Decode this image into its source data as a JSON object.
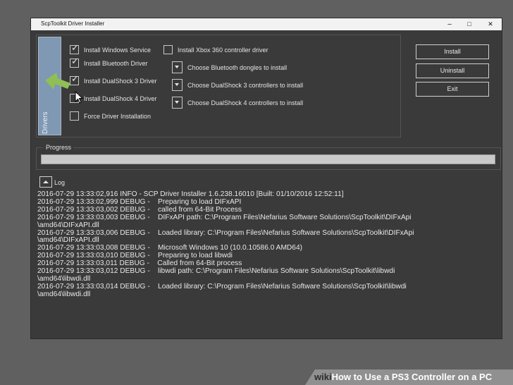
{
  "window": {
    "title": "ScpToolkit Driver Installer",
    "minimize_glyph": "–",
    "maximize_glyph": "□",
    "close_glyph": "✕"
  },
  "drivers": {
    "tab_label": "Drivers",
    "checkboxes": [
      {
        "label": "Install Windows Service",
        "checked": true
      },
      {
        "label": "Install Bluetooth Driver",
        "checked": true
      },
      {
        "label": "Install DualShock 3 Driver",
        "checked": true
      },
      {
        "label": "Install DualShock 4 Driver",
        "checked": false
      },
      {
        "label": "Force Driver Installation",
        "checked": false
      },
      {
        "label": "Install Xbox 360 controller driver",
        "checked": false
      }
    ],
    "check_glyph": "✓",
    "dropdowns": [
      {
        "label": "Choose Bluetooth dongles to install"
      },
      {
        "label": "Choose DualShock 3 controllers to install"
      },
      {
        "label": "Choose DualShock 4 controllers to install"
      }
    ]
  },
  "actions": {
    "install": "Install",
    "uninstall": "Uninstall",
    "exit": "Exit"
  },
  "progress": {
    "label": "Progress",
    "value": 0
  },
  "log": {
    "label": "Log",
    "lines": [
      "2016-07-29 13:33:02,916 INFO - SCP Driver Installer 1.6.238.16010 [Built: 01/10/2016 12:52:11]",
      "2016-07-29 13:33:02,999 DEBUG -    Preparing to load DIFxAPI",
      "2016-07-29 13:33:03,002 DEBUG -    called from 64-Bit Process",
      "2016-07-29 13:33:03,003 DEBUG -    DIFxAPI path: C:\\Program Files\\Nefarius Software Solutions\\ScpToolkit\\DIFxApi",
      "\\amd64\\DIFxAPI.dll",
      "2016-07-29 13:33:03,006 DEBUG -    Loaded library: C:\\Program Files\\Nefarius Software Solutions\\ScpToolkit\\DIFxApi",
      "\\amd64\\DIFxAPI.dll",
      "2016-07-29 13:33:03,008 DEBUG -    Microsoft Windows 10 (10.0.10586.0 AMD64)",
      "2016-07-29 13:33:03,010 DEBUG -    Preparing to load libwdi",
      "2016-07-29 13:33:03,011 DEBUG -    Called from 64-Bit process",
      "2016-07-29 13:33:03,012 DEBUG -    libwdi path: C:\\Program Files\\Nefarius Software Solutions\\ScpToolkit\\libwdi",
      "\\amd64\\libwdi.dll",
      "2016-07-29 13:33:03,014 DEBUG -    Loaded library: C:\\Program Files\\Nefarius Software Solutions\\ScpToolkit\\libwdi",
      "\\amd64\\libwdi.dll"
    ]
  },
  "annotation": {
    "arrow_color": "#8fbf55",
    "cursor_icon": "mouse-pointer-icon"
  },
  "watermark": {
    "brand": "wiki",
    "text": "How to Use a PS3 Controller on a PC"
  }
}
